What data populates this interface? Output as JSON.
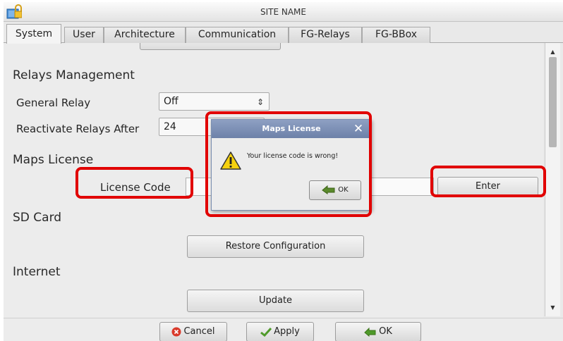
{
  "window": {
    "title": "SITE NAME",
    "app_icon": "padlock-folder-icon"
  },
  "tabs": [
    {
      "label": "System",
      "active": true
    },
    {
      "label": "User",
      "active": false
    },
    {
      "label": "Architecture",
      "active": false
    },
    {
      "label": "Communication",
      "active": false
    },
    {
      "label": "FG-Relays",
      "active": false
    },
    {
      "label": "FG-BBox",
      "active": false
    }
  ],
  "relays": {
    "heading": "Relays Management",
    "general_label": "General Relay",
    "general_value": "Off",
    "reactivate_label": "Reactivate Relays After",
    "reactivate_value": "24"
  },
  "maps": {
    "heading": "Maps License",
    "code_label": "License Code",
    "code_value": "",
    "enter_label": "Enter"
  },
  "sd": {
    "heading": "SD Card",
    "restore_label": "Restore Configuration"
  },
  "internet": {
    "heading": "Internet",
    "update_label": "Update"
  },
  "dialog": {
    "title": "Maps License",
    "message": "Your license code is wrong!",
    "ok_label": "OK",
    "icon": "warning-icon"
  },
  "footer": {
    "cancel_label": "Cancel",
    "apply_label": "Apply",
    "ok_label": "OK"
  },
  "colors": {
    "highlight": "#e10000",
    "dialog_title": "#7b8fb6",
    "background": "#ececec"
  }
}
